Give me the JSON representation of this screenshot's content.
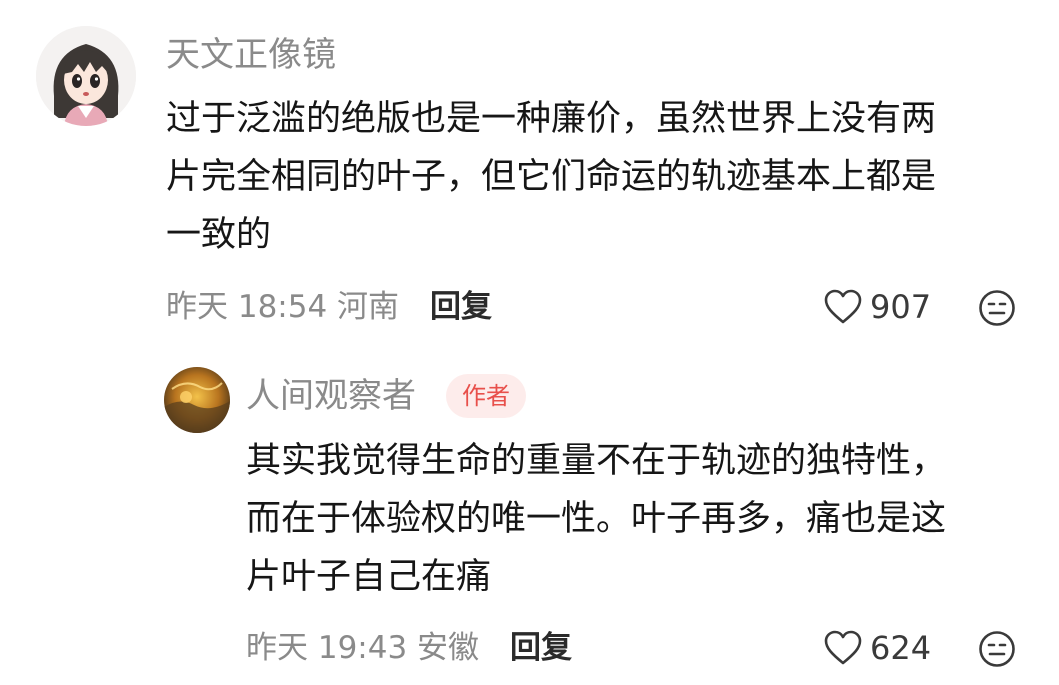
{
  "comments": [
    {
      "username": "天文正像镜",
      "content_lines": [
        "过于泛滥的绝版也是一种廉价，虽然世界上没有两",
        "片完全相同的叶子，但它们命运的轨迹基本上都是",
        "一致的"
      ],
      "meta": "昨天 18:54 河南",
      "reply_label": "回复",
      "like_count": "907",
      "avatar_icon": "anime-girl-avatar",
      "emoji_icon": "emoji-reaction-icon",
      "like_icon": "heart-outline-icon"
    },
    {
      "username": "人间观察者",
      "badge": "作者",
      "content_lines": [
        "其实我觉得生命的重量不在于轨迹的独特性，",
        "而在于体验权的唯一性。叶子再多，痛也是这",
        "片叶子自己在痛"
      ],
      "meta": "昨天 19:43 安徽",
      "reply_label": "回复",
      "like_count": "624",
      "avatar_icon": "golden-landscape-avatar",
      "emoji_icon": "emoji-reaction-icon",
      "like_icon": "heart-outline-icon"
    }
  ],
  "colors": {
    "text_primary": "#161616",
    "text_secondary": "#8a8a8a",
    "badge_bg": "#fdeceb",
    "badge_text": "#e8504b"
  }
}
